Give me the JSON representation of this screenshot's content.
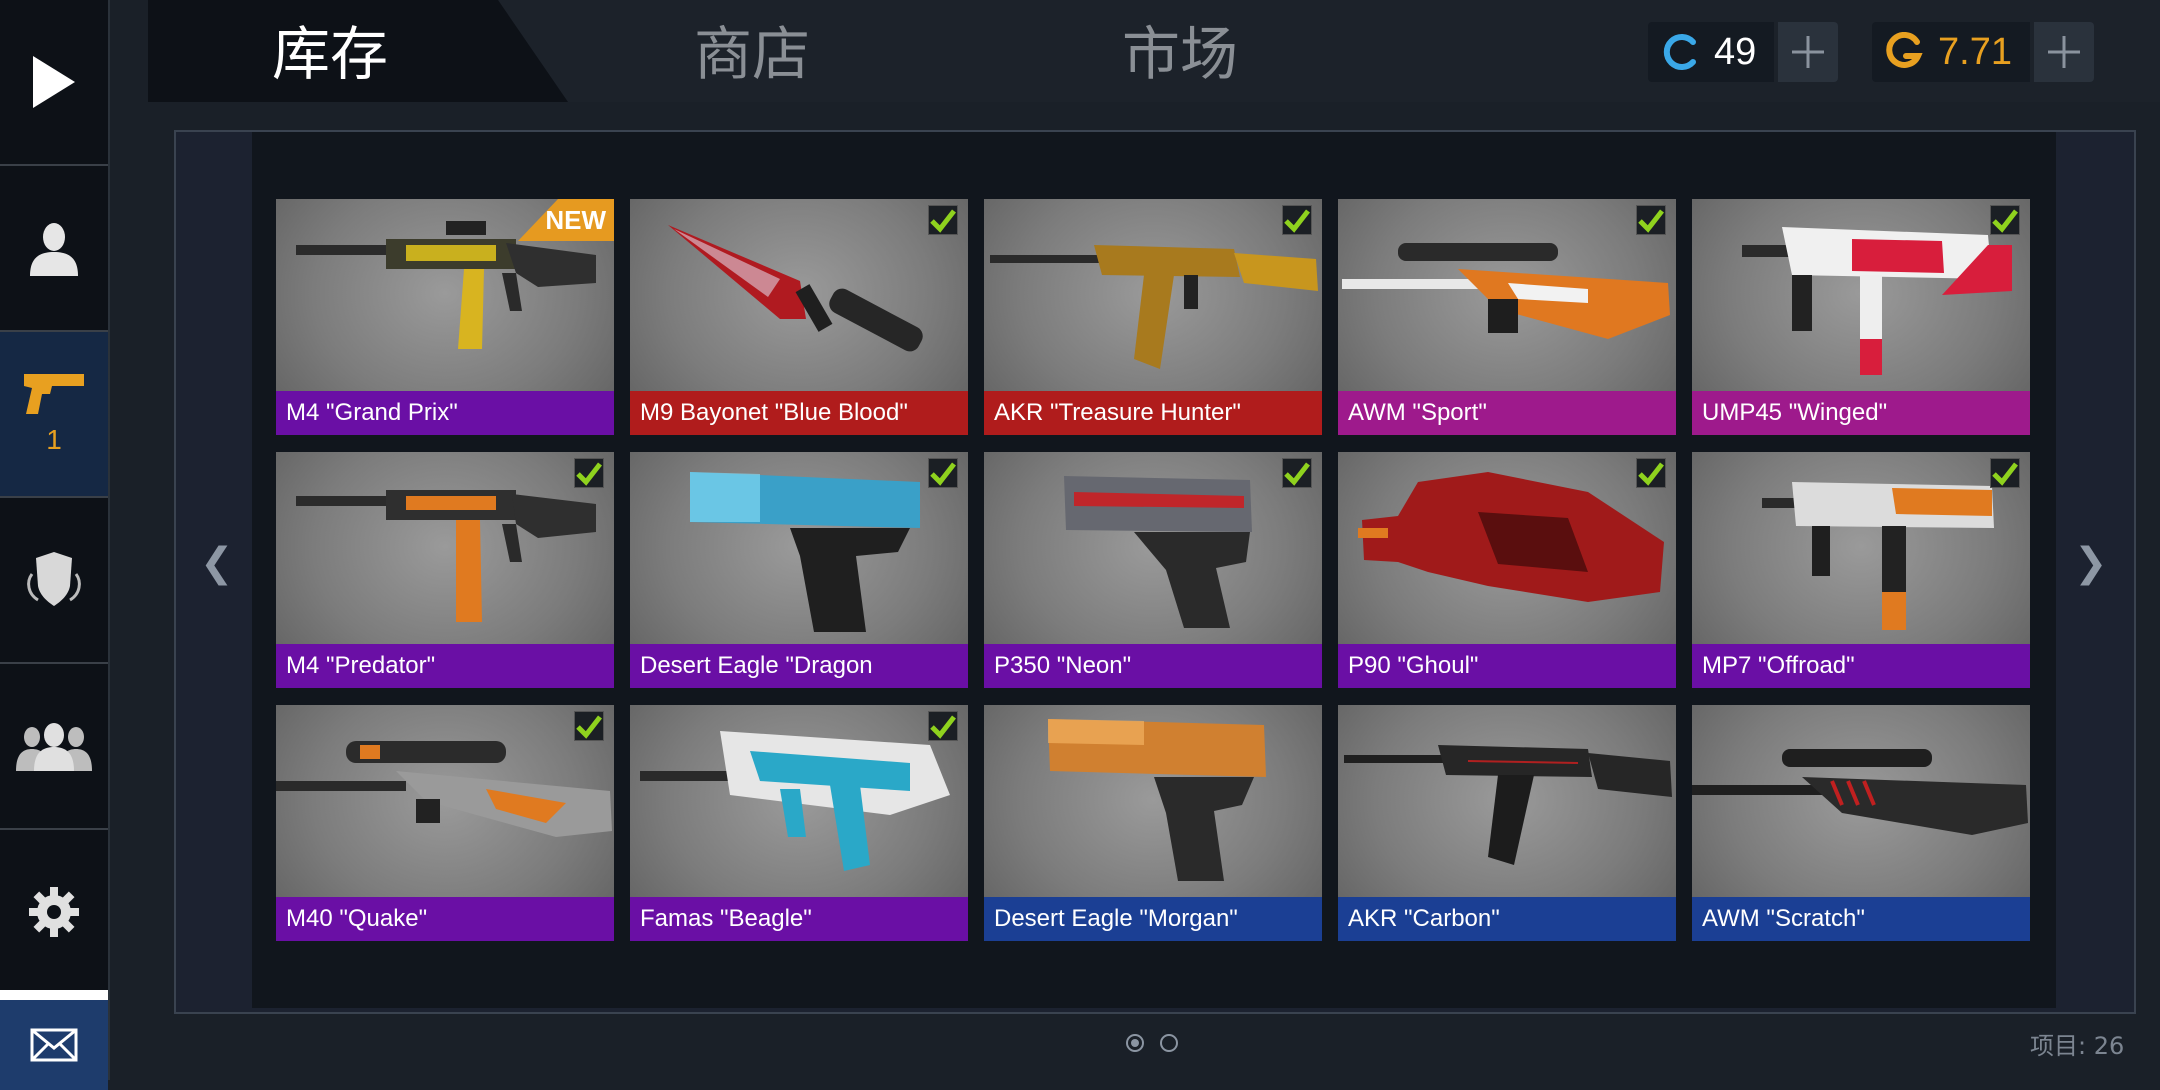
{
  "tabs": [
    {
      "label": "库存"
    },
    {
      "label": "商店"
    },
    {
      "label": "市场"
    }
  ],
  "currency": {
    "credits": {
      "value": "49",
      "icon": "c-coin-icon",
      "color": "#3aa8e8"
    },
    "gold": {
      "value": "7.71",
      "icon": "g-coin-icon",
      "color": "#e8a020"
    }
  },
  "sidebar": {
    "items": [
      {
        "name": "play",
        "icon": "play-icon"
      },
      {
        "name": "profile",
        "icon": "user-icon"
      },
      {
        "name": "inventory",
        "icon": "pistol-icon",
        "count": "1"
      },
      {
        "name": "clan",
        "icon": "shield-icon"
      },
      {
        "name": "friends",
        "icon": "group-icon"
      },
      {
        "name": "settings",
        "icon": "gear-icon"
      },
      {
        "name": "mail",
        "icon": "mail-icon"
      }
    ]
  },
  "items": [
    {
      "name": "M4 \"Grand Prix\"",
      "rarity": "purple",
      "badge": "NEW",
      "equipped": false
    },
    {
      "name": "M9 Bayonet \"Blue Blood\"",
      "rarity": "red",
      "equipped": true
    },
    {
      "name": "AKR \"Treasure Hunter\"",
      "rarity": "red",
      "equipped": true
    },
    {
      "name": "AWM \"Sport\"",
      "rarity": "pink",
      "equipped": true
    },
    {
      "name": "UMP45 \"Winged\"",
      "rarity": "pink",
      "equipped": true
    },
    {
      "name": "M4 \"Predator\"",
      "rarity": "purple",
      "equipped": true
    },
    {
      "name": "Desert Eagle \"Dragon",
      "rarity": "purple",
      "equipped": true
    },
    {
      "name": "P350 \"Neon\"",
      "rarity": "purple",
      "equipped": true
    },
    {
      "name": "P90 \"Ghoul\"",
      "rarity": "purple",
      "equipped": true
    },
    {
      "name": "MP7 \"Offroad\"",
      "rarity": "purple",
      "equipped": true
    },
    {
      "name": "M40 \"Quake\"",
      "rarity": "purple",
      "equipped": true
    },
    {
      "name": "Famas \"Beagle\"",
      "rarity": "purple",
      "equipped": true
    },
    {
      "name": "Desert Eagle \"Morgan\"",
      "rarity": "blue",
      "equipped": false
    },
    {
      "name": "AKR \"Carbon\"",
      "rarity": "blue",
      "equipped": false
    },
    {
      "name": "AWM \"Scratch\"",
      "rarity": "blue",
      "equipped": false
    }
  ],
  "rarity_colors": {
    "purple": "#6a0fa5",
    "red": "#b01c1c",
    "pink": "#9e1a8c",
    "blue": "#1b3f94"
  },
  "arrows": {
    "left": "❮",
    "right": "❯"
  },
  "footer": {
    "items_count": "项目: 26",
    "page_current": 1,
    "page_total": 2
  }
}
